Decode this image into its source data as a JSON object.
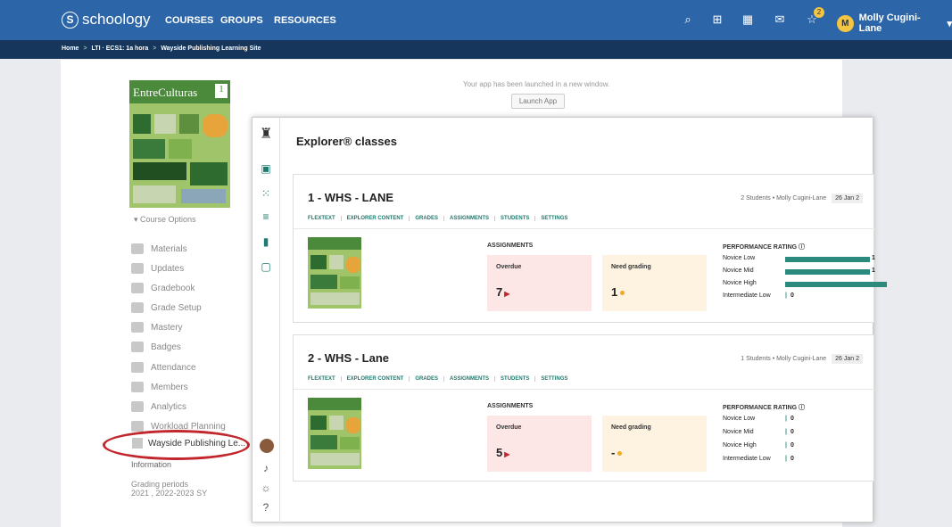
{
  "topbar": {
    "logo": "schoology",
    "nav": [
      "COURSES",
      "GROUPS",
      "RESOURCES"
    ],
    "notif_count": "2",
    "user_initial": "M",
    "user": "Molly Cugini-Lane"
  },
  "breadcrumb": {
    "home": "Home",
    "course": "LTI · ECS1: 1a hora",
    "site": "Wayside Publishing Learning Site"
  },
  "colors": {
    "topbar": "#2c66a8",
    "breadcrumb": "#16365c",
    "accent": "#1e7a6e",
    "overdue": "#fde6e6",
    "needgrade": "#fdf3e0",
    "highlight": "#c1272d"
  },
  "sidebar": {
    "cover_title": "EntreCulturas",
    "cover_num": "1",
    "course_options": "▾ Course Options",
    "items": [
      "Materials",
      "Updates",
      "Gradebook",
      "Grade Setup",
      "Mastery",
      "Badges",
      "Attendance",
      "Members",
      "Analytics",
      "Workload Planning"
    ],
    "wayside": "Wayside Publishing Le...",
    "info": "Information",
    "grading_label": "Grading periods",
    "grading_value": "2021 , 2022-2023 SY"
  },
  "launch": {
    "message": "Your app has been launched in a new window.",
    "button": "Launch App"
  },
  "explorer": {
    "title": "Explorer® classes",
    "tabs": [
      "FLEXTEXT",
      "EXPLORER CONTENT",
      "GRADES",
      "ASSIGNMENTS",
      "STUDENTS",
      "SETTINGS"
    ],
    "assignments_label": "ASSIGNMENTS",
    "overdue_label": "Overdue",
    "needgrading_label": "Need grading",
    "performance_label": "PERFORMANCE RATING ⓘ",
    "classes": [
      {
        "name": "1 - WHS - LANE",
        "meta": "2 Students • Molly Cugini-Lane",
        "date": "26 Jan 2",
        "overdue": "7",
        "needgrading": "1",
        "ratings": [
          {
            "label": "Novice Low",
            "count": "1",
            "frac": 0.5
          },
          {
            "label": "Novice Mid",
            "count": "1",
            "frac": 0.5
          },
          {
            "label": "Novice High",
            "count": "",
            "frac": 0.6
          },
          {
            "label": "Intermediate Low",
            "count": "0",
            "frac": 0
          }
        ]
      },
      {
        "name": "2 - WHS - Lane",
        "meta": "1 Students • Molly Cugini-Lane",
        "date": "26 Jan 2",
        "overdue": "5",
        "needgrading": "-",
        "ratings": [
          {
            "label": "Novice Low",
            "count": "0",
            "frac": 0
          },
          {
            "label": "Novice Mid",
            "count": "0",
            "frac": 0
          },
          {
            "label": "Novice High",
            "count": "0",
            "frac": 0
          },
          {
            "label": "Intermediate Low",
            "count": "0",
            "frac": 0
          }
        ]
      }
    ]
  }
}
